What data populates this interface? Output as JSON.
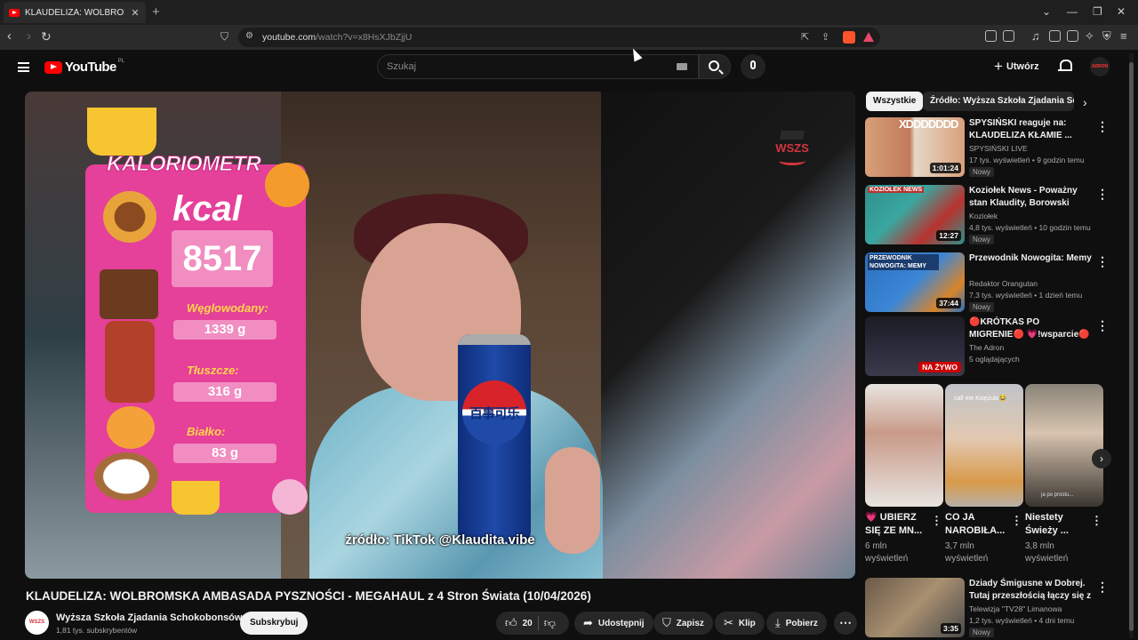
{
  "browser": {
    "tab_title": "KLAUDELIZA: WOLBROMSKA AM",
    "url_host": "youtube.com",
    "url_path": "/watch?v=x8HsXJbZjjU"
  },
  "header": {
    "logo_text": "YouTube",
    "region": "PL",
    "search_placeholder": "Szukaj",
    "create_label": "Utwórz",
    "avatar_text": "ADRON"
  },
  "player": {
    "overlay_title": "KALORIOMETR",
    "kcal_label": "kcal",
    "kcal_value": "8517",
    "carbs_label": "Węglowodany:",
    "carbs_value": "1339 g",
    "fat_label": "Tłuszcze:",
    "fat_value": "316 g",
    "protein_label": "Białko:",
    "protein_value": "83 g",
    "can_text": "百事可乐",
    "watermark": "WSZS",
    "caption": "źródło: TikTok @Klaudita.vibe"
  },
  "video": {
    "title": "KLAUDELIZA: WOLBROMSKA AMBASADA PYSZNOŚCI - MEGAHAUL z 4 Stron Świata (10/04/2026)",
    "channel_name": "Wyższa Szkoła Zjadania Schokobonsów",
    "channel_avatar_text": "WSZS",
    "subscribers": "1,81 tys. subskrybentów",
    "subscribe_label": "Subskrybuj",
    "like_count": "20",
    "share_label": "Udostępnij",
    "save_label": "Zapisz",
    "clip_label": "Klip",
    "download_label": "Pobierz"
  },
  "sidebar": {
    "chips": [
      "Wszystkie",
      "Źródło: Wyższa Szkoła Zjadania Schokobonsów"
    ],
    "recommendations": [
      {
        "title": "SPYSIŃSKI reaguje na: KLAUDELIZA KŁAMIE ...",
        "channel": "SPYSIŃSKI LIVE",
        "meta": "17 tys. wyświetleń • 9 godzin temu",
        "badge": "Nowy",
        "duration": "1:01:24",
        "thumb_text": "XDDDDDDD"
      },
      {
        "title": "Koziołek News - Poważny stan Klaudity, Borowski okradziony,...",
        "channel": "Koziołek",
        "meta": "4,8 tys. wyświetleń • 10 godzin temu",
        "badge": "Nowy",
        "duration": "12:27",
        "thumb_text": "KOZIOŁEK NEWS"
      },
      {
        "title": "Przewodnik Nowogita: Memy",
        "channel": "Redaktor Orangutan",
        "meta": "7,3 tys. wyświetleń • 1 dzień temu",
        "badge": "Nowy",
        "duration": "37:44",
        "thumb_text": "PRZEWODNIK NOWOGITA: MEMY"
      },
      {
        "title": "🔴KRÓTKAS PO MIGRENIE🔴 💗!wsparcie🔴 !donate",
        "channel": "The Adron",
        "meta": "5 oglądających",
        "badge": "",
        "duration": "NA ŻYWO",
        "thumb_text": ""
      },
      {
        "title": "Dziady Śmigusne w Dobrej. Tutaj przeszłością łączy się z ...",
        "channel": "Telewizja \"TV28\" Limanowa",
        "meta": "1,2 tys. wyświetleń • 4 dni temu",
        "badge": "Nowy",
        "duration": "3:35",
        "thumb_text": ""
      }
    ],
    "shorts": [
      {
        "title": "💗 UBIERZ SIĘ ZE MN...",
        "views": "6 mln\nwyświetleń",
        "thumb_text": ""
      },
      {
        "title": "CO JA NAROBIŁA...",
        "views": "3,7 mln\nwyświetleń",
        "thumb_text": "call me Księżulo😂"
      },
      {
        "title": "Niestety Świeży ...",
        "views": "3,8 mln\nwyświetleń",
        "thumb_text": "ja po prostu..."
      }
    ]
  }
}
